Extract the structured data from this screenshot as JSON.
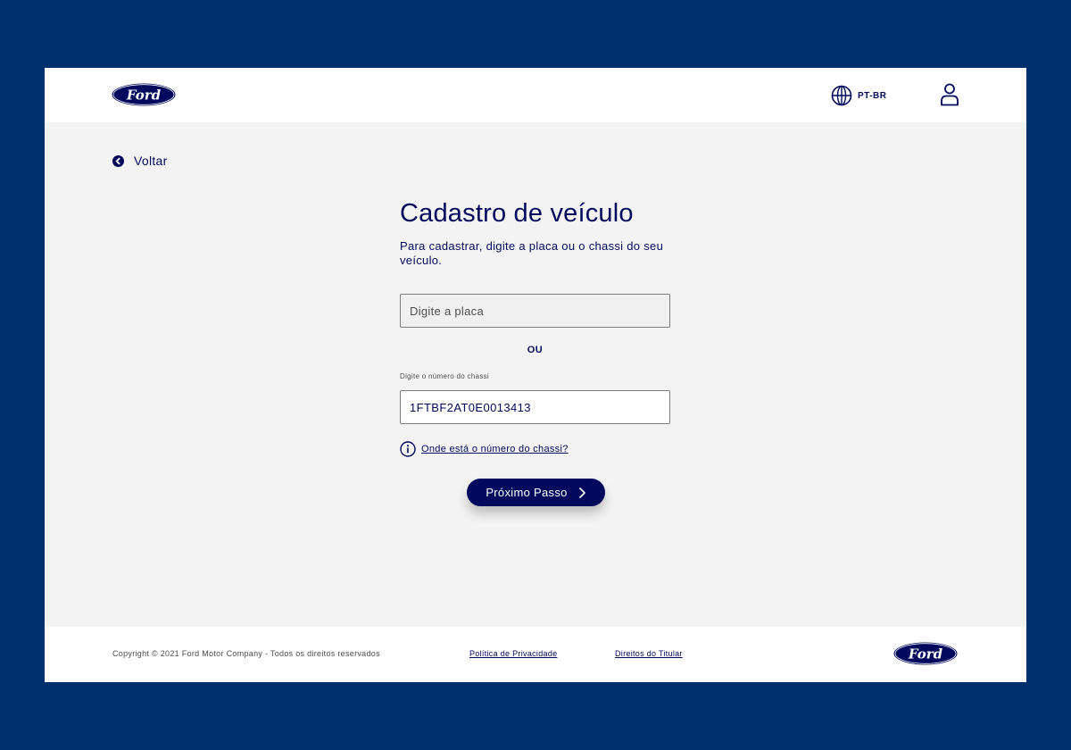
{
  "header": {
    "logo_text": "Ford",
    "language_label": "PT-BR"
  },
  "back": {
    "label": "Voltar"
  },
  "form": {
    "title": "Cadastro de veículo",
    "subtitle": "Para cadastrar, digite a placa ou o chassi do seu veículo.",
    "plate_placeholder": "Digite a placa",
    "plate_value": "",
    "or_label": "OU",
    "chassis_label": "Digite o número do chassi",
    "chassis_value": "1FTBF2AT0E0013413",
    "help_link": "Onde está o número do chassi?",
    "next_button": "Próximo Passo"
  },
  "footer": {
    "copyright": "Copyright © 2021 Ford Motor Company - Todos os direitos reservados",
    "privacy_link": "Política de Privacidade",
    "rights_link": "Direitos do Titular",
    "logo_text": "Ford"
  },
  "colors": {
    "page_background": "#00306b",
    "brand_navy": "#00095b",
    "content_background": "#f3f3f3",
    "surface": "#ffffff"
  },
  "icons": {
    "language": "globe-icon",
    "user": "user-icon",
    "back": "chevron-left-circle-icon",
    "help": "info-icon",
    "next": "chevron-right-icon"
  }
}
